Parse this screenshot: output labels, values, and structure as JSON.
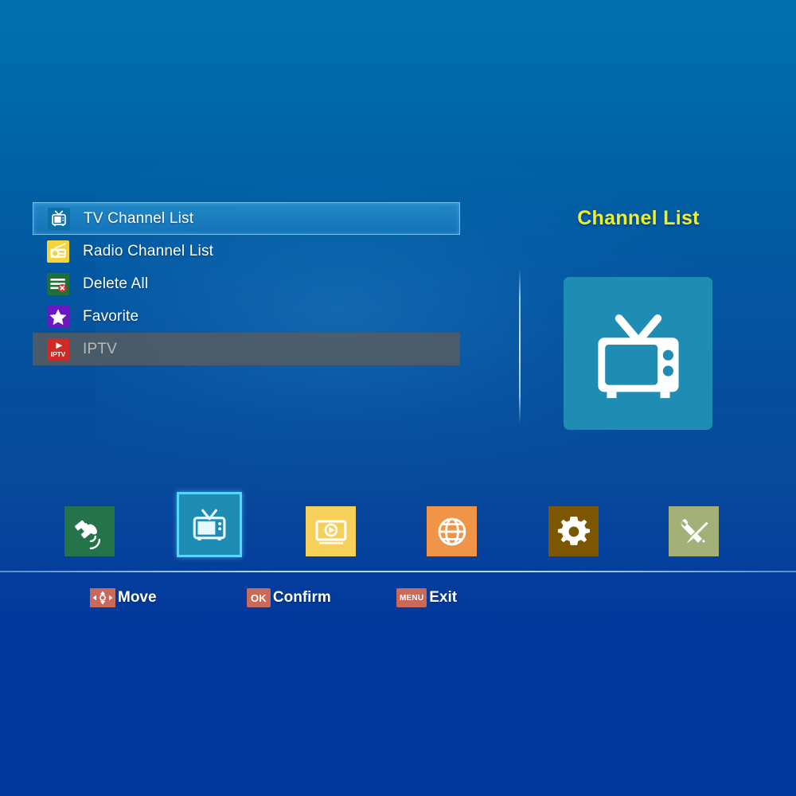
{
  "screen": {
    "title": "Channel List",
    "background_top_color": "#0070ac",
    "background_bottom_color": "#03389c"
  },
  "menu": {
    "items": [
      {
        "label": "TV Channel List",
        "icon": "tv-icon",
        "state": "selected"
      },
      {
        "label": "Radio Channel List",
        "icon": "radio-icon",
        "state": "normal"
      },
      {
        "label": "Delete All",
        "icon": "delete-all-icon",
        "state": "normal"
      },
      {
        "label": "Favorite",
        "icon": "star-icon",
        "state": "normal"
      },
      {
        "label": "IPTV",
        "icon": "iptv-icon",
        "state": "disabled"
      }
    ]
  },
  "panel": {
    "title": "Channel List",
    "title_color": "#f2ee2a",
    "tile_icon": "tv-icon",
    "tile_color": "#1f8cb3"
  },
  "toolbar": {
    "items": [
      {
        "name": "satellite",
        "icon": "satellite-icon",
        "color": "#24734a",
        "selected": false
      },
      {
        "name": "tv",
        "icon": "tv-icon",
        "color": "#1f8cb3",
        "selected": true
      },
      {
        "name": "media",
        "icon": "media-player-icon",
        "color": "#f7d05a",
        "selected": false
      },
      {
        "name": "network",
        "icon": "globe-icon",
        "color": "#f09447",
        "selected": false
      },
      {
        "name": "settings",
        "icon": "gear-icon",
        "color": "#7d5602",
        "selected": false
      },
      {
        "name": "tools",
        "icon": "tools-icon",
        "color": "#a3b179",
        "selected": false
      }
    ]
  },
  "hints": [
    {
      "key": "",
      "icon": "dpad-icon",
      "label": "Move"
    },
    {
      "key": "OK",
      "icon": "",
      "label": "Confirm"
    },
    {
      "key": "MENU",
      "icon": "",
      "label": "Exit"
    }
  ]
}
